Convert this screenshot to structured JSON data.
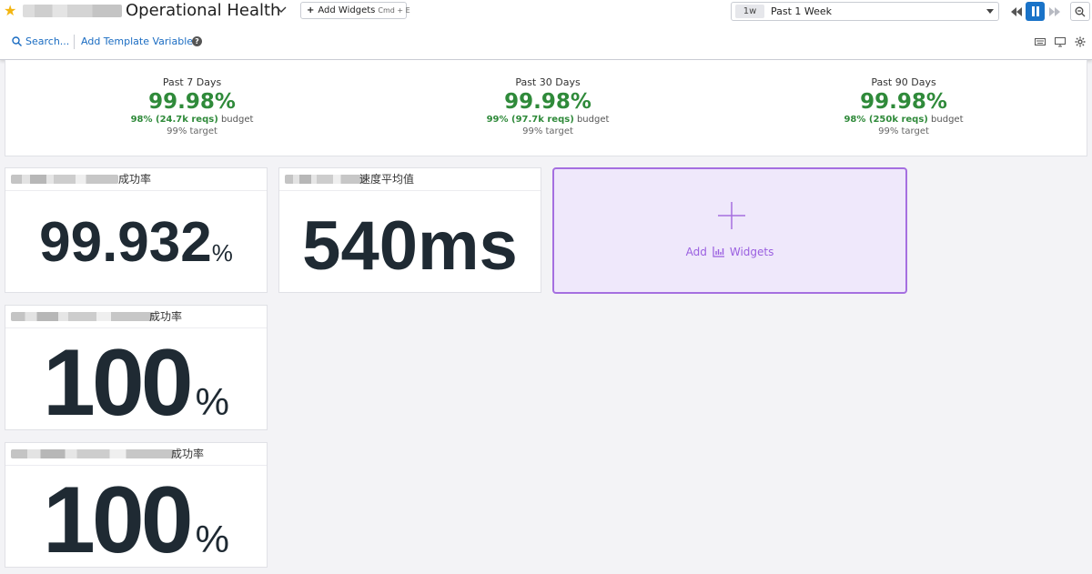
{
  "header": {
    "title": "Operational Health",
    "add_widgets_label": "Add Widgets",
    "add_widgets_shortcut": "Cmd + E",
    "time_badge": "1w",
    "time_label": "Past 1 Week",
    "search_label": "Search...",
    "template_vars_label": "Add Template Variables",
    "help_label": "?"
  },
  "slo": [
    {
      "period": "Past 7 Days",
      "value": "99.98%",
      "budget_bold": "98% (24.7k reqs)",
      "budget_suffix": "budget",
      "target": "99% target"
    },
    {
      "period": "Past 30 Days",
      "value": "99.98%",
      "budget_bold": "99% (97.7k reqs)",
      "budget_suffix": "budget",
      "target": "99% target"
    },
    {
      "period": "Past 90 Days",
      "value": "99.98%",
      "budget_bold": "98% (250k reqs)",
      "budget_suffix": "budget",
      "target": "99% target"
    }
  ],
  "widgets": [
    {
      "title_suffix": "成功率",
      "value": "99.932",
      "unit": "%"
    },
    {
      "title_suffix": "速度平均值",
      "value": "540ms",
      "unit": ""
    },
    {
      "title_suffix": "成功率",
      "value": "100",
      "unit": "%"
    },
    {
      "title_suffix": "成功率",
      "value": "100",
      "unit": "%"
    }
  ],
  "add_tile": {
    "label_left": "Add",
    "label_right": "Widgets"
  },
  "colors": {
    "accent": "#1a73c8",
    "ok": "#2f8a3a",
    "add_purple": "#a56fe0",
    "star": "#f3b510"
  }
}
